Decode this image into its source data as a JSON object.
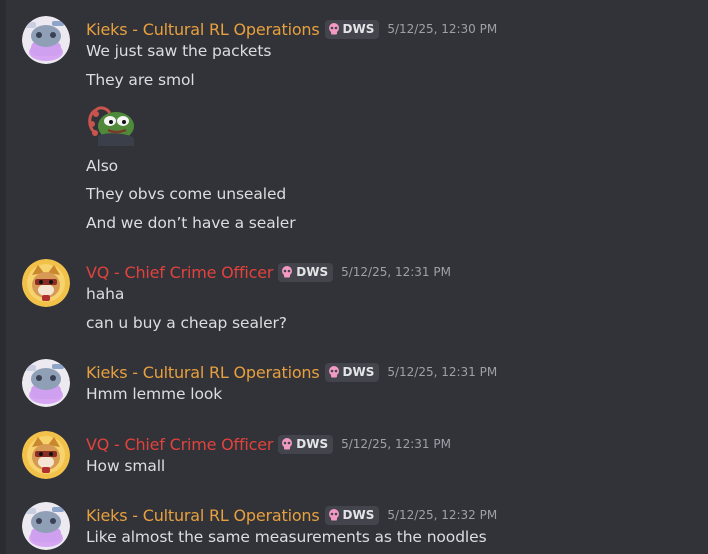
{
  "colors": {
    "background": "#323339",
    "kieks_name": "#e8a03e",
    "vq_name": "#e2423c",
    "tag_bg": "#44454c",
    "text": "#dcdde1",
    "timestamp": "#9ea0a7"
  },
  "messages": [
    {
      "author": "Kieks - Cultural RL Operations",
      "tag": "DWS",
      "tag_icon": "pink-skull-icon",
      "timestamp": "5/12/25, 12:30 PM",
      "lines": [
        "We just saw the packets",
        "They are smol"
      ],
      "emoji": "pepe-emoji",
      "lines_after": [
        "Also",
        "They obvs come unsealed",
        "And we don’t have a sealer"
      ]
    },
    {
      "author": "VQ - Chief Crime Officer",
      "tag": "DWS",
      "tag_icon": "pink-skull-icon",
      "timestamp": "5/12/25, 12:31 PM",
      "lines": [
        "haha",
        "can u buy a cheap sealer?"
      ]
    },
    {
      "author": "Kieks - Cultural RL Operations",
      "tag": "DWS",
      "tag_icon": "pink-skull-icon",
      "timestamp": "5/12/25, 12:31 PM",
      "lines": [
        "Hmm lemme look"
      ]
    },
    {
      "author": "VQ - Chief Crime Officer",
      "tag": "DWS",
      "tag_icon": "pink-skull-icon",
      "timestamp": "5/12/25, 12:31 PM",
      "lines": [
        "How small"
      ]
    },
    {
      "author": "Kieks - Cultural RL Operations",
      "tag": "DWS",
      "tag_icon": "pink-skull-icon",
      "timestamp": "5/12/25, 12:32 PM",
      "lines": [
        "Like almost the same measurements as the noodles"
      ]
    }
  ]
}
